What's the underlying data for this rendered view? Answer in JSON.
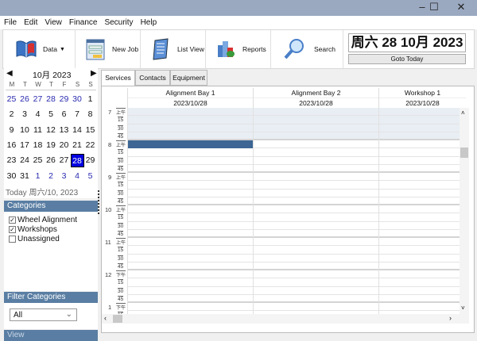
{
  "window": {
    "minimize": "–",
    "maximize": "☐",
    "close": "✕"
  },
  "menu": [
    "File",
    "Edit",
    "View",
    "Finance",
    "Security",
    "Help"
  ],
  "toolbar": {
    "data": "Data",
    "new_job": "New Job",
    "list_view": "List View",
    "reports": "Reports",
    "search": "Search",
    "date_display": "周六 28 10月 2023",
    "goto_today": "Goto Today"
  },
  "calendar": {
    "title": "10月 2023",
    "weekdays": [
      "M",
      "T",
      "W",
      "T",
      "F",
      "S",
      "S"
    ],
    "weeks": [
      [
        "25",
        "26",
        "27",
        "28",
        "29",
        "30",
        "1"
      ],
      [
        "2",
        "3",
        "4",
        "5",
        "6",
        "7",
        "8"
      ],
      [
        "9",
        "10",
        "11",
        "12",
        "13",
        "14",
        "15"
      ],
      [
        "16",
        "17",
        "18",
        "19",
        "20",
        "21",
        "22"
      ],
      [
        "23",
        "24",
        "25",
        "26",
        "27",
        "28",
        "29"
      ],
      [
        "30",
        "31",
        "1",
        "2",
        "3",
        "4",
        "5"
      ]
    ],
    "selected": "28",
    "today_text": "Today 周六/10, 2023"
  },
  "categories": {
    "header": "Categories",
    "items": [
      {
        "label": "Wheel Alignment",
        "checked": true
      },
      {
        "label": "Workshops",
        "checked": true
      },
      {
        "label": "Unassigned",
        "checked": false
      }
    ]
  },
  "filter": {
    "header": "Filter Categories",
    "value": "All"
  },
  "view": {
    "header": "View"
  },
  "tabs": [
    "Services",
    "Contacts",
    "Equipment"
  ],
  "schedule": {
    "columns": [
      {
        "name": "Alignment Bay 1",
        "date": "2023/10/28"
      },
      {
        "name": "Alignment Bay 2",
        "date": "2023/10/28"
      },
      {
        "name": "Workshop 1",
        "date": "2023/10/28"
      }
    ],
    "hours": [
      {
        "h": "7",
        "p": "上午"
      },
      {
        "h": "8",
        "p": "上午"
      },
      {
        "h": "9",
        "p": "上午"
      },
      {
        "h": "10",
        "p": "上午"
      },
      {
        "h": "11",
        "p": "上午"
      },
      {
        "h": "12",
        "p": "下午"
      },
      {
        "h": "1",
        "p": "下午"
      }
    ],
    "minutes": [
      "15",
      "30",
      "45"
    ],
    "selected_slot": "8:00 Alignment Bay 1",
    "colors": {
      "off_hours": "#e9eef4",
      "selected": "#3d6694"
    }
  }
}
